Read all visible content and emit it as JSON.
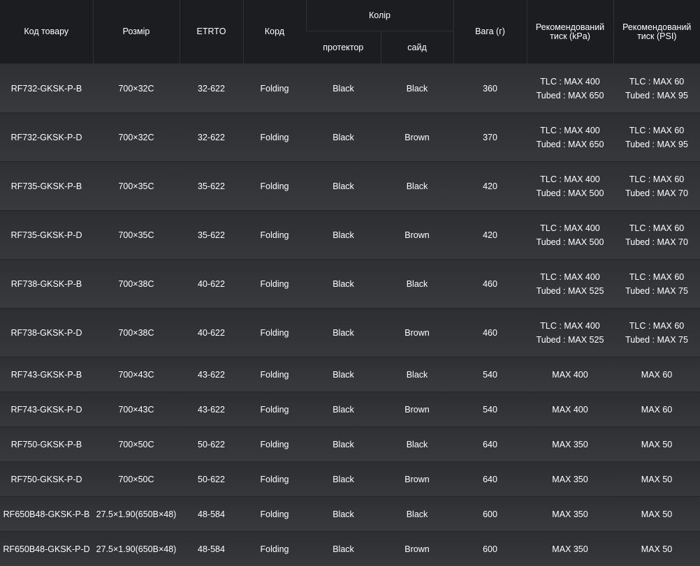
{
  "header": {
    "code": "Код товару",
    "size": "Розмір",
    "etrto": "ETRTO",
    "cord": "Корд",
    "color": "Колір",
    "tread": "протектор",
    "side": "сайд",
    "weight": "Вага (г)",
    "kpa": "Рекомендований тиск (kPa)",
    "psi": "Рекомендований тиск (PSI)"
  },
  "rows": [
    {
      "code": "RF732-GKSK-P-B",
      "size": "700×32C",
      "etrto": "32-622",
      "cord": "Folding",
      "tread": "Black",
      "side": "Black",
      "weight": "360",
      "kpa": [
        "TLC : MAX 400",
        "Tubed : MAX 650"
      ],
      "psi": [
        "TLC : MAX 60",
        "Tubed : MAX 95"
      ]
    },
    {
      "code": "RF732-GKSK-P-D",
      "size": "700×32C",
      "etrto": "32-622",
      "cord": "Folding",
      "tread": "Black",
      "side": "Brown",
      "weight": "370",
      "kpa": [
        "TLC : MAX 400",
        "Tubed : MAX 650"
      ],
      "psi": [
        "TLC : MAX 60",
        "Tubed : MAX 95"
      ]
    },
    {
      "code": "RF735-GKSK-P-B",
      "size": "700×35C",
      "etrto": "35-622",
      "cord": "Folding",
      "tread": "Black",
      "side": "Black",
      "weight": "420",
      "kpa": [
        "TLC : MAX 400",
        "Tubed : MAX 500"
      ],
      "psi": [
        "TLC : MAX 60",
        "Tubed : MAX 70"
      ]
    },
    {
      "code": "RF735-GKSK-P-D",
      "size": "700×35C",
      "etrto": "35-622",
      "cord": "Folding",
      "tread": "Black",
      "side": "Brown",
      "weight": "420",
      "kpa": [
        "TLC : MAX 400",
        "Tubed : MAX 500"
      ],
      "psi": [
        "TLC : MAX 60",
        "Tubed : MAX 70"
      ]
    },
    {
      "code": "RF738-GKSK-P-B",
      "size": "700×38C",
      "etrto": "40-622",
      "cord": "Folding",
      "tread": "Black",
      "side": "Black",
      "weight": "460",
      "kpa": [
        "TLC : MAX 400",
        "Tubed : MAX 525"
      ],
      "psi": [
        "TLC : MAX 60",
        "Tubed : MAX 75"
      ]
    },
    {
      "code": "RF738-GKSK-P-D",
      "size": "700×38C",
      "etrto": "40-622",
      "cord": "Folding",
      "tread": "Black",
      "side": "Brown",
      "weight": "460",
      "kpa": [
        "TLC : MAX 400",
        "Tubed : MAX 525"
      ],
      "psi": [
        "TLC : MAX 60",
        "Tubed : MAX 75"
      ]
    },
    {
      "code": "RF743-GKSK-P-B",
      "size": "700×43C",
      "etrto": "43-622",
      "cord": "Folding",
      "tread": "Black",
      "side": "Black",
      "weight": "540",
      "kpa": [
        "MAX 400"
      ],
      "psi": [
        "MAX 60"
      ]
    },
    {
      "code": "RF743-GKSK-P-D",
      "size": "700×43C",
      "etrto": "43-622",
      "cord": "Folding",
      "tread": "Black",
      "side": "Brown",
      "weight": "540",
      "kpa": [
        "MAX 400"
      ],
      "psi": [
        "MAX 60"
      ]
    },
    {
      "code": "RF750-GKSK-P-B",
      "size": "700×50C",
      "etrto": "50-622",
      "cord": "Folding",
      "tread": "Black",
      "side": "Black",
      "weight": "640",
      "kpa": [
        "MAX 350"
      ],
      "psi": [
        "MAX 50"
      ]
    },
    {
      "code": "RF750-GKSK-P-D",
      "size": "700×50C",
      "etrto": "50-622",
      "cord": "Folding",
      "tread": "Black",
      "side": "Brown",
      "weight": "640",
      "kpa": [
        "MAX 350"
      ],
      "psi": [
        "MAX 50"
      ]
    },
    {
      "code": "RF650B48-GKSK-P-B",
      "size": "27.5×1.90(650B×48)",
      "etrto": "48-584",
      "cord": "Folding",
      "tread": "Black",
      "side": "Black",
      "weight": "600",
      "kpa": [
        "MAX 350"
      ],
      "psi": [
        "MAX 50"
      ]
    },
    {
      "code": "RF650B48-GKSK-P-D",
      "size": "27.5×1.90(650B×48)",
      "etrto": "48-584",
      "cord": "Folding",
      "tread": "Black",
      "side": "Brown",
      "weight": "600",
      "kpa": [
        "MAX 350"
      ],
      "psi": [
        "MAX 50"
      ]
    }
  ]
}
